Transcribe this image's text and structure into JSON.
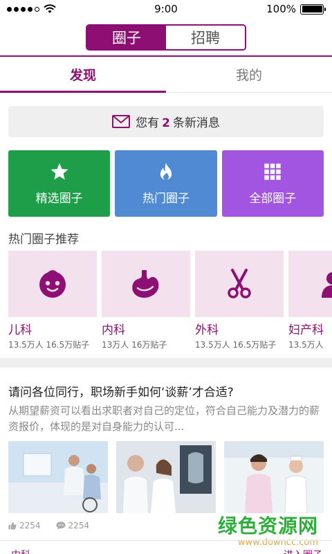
{
  "status_bar": {
    "time": "9:00",
    "battery": "100%"
  },
  "header": {
    "segments": [
      {
        "label": "圈子",
        "active": true
      },
      {
        "label": "招聘",
        "active": false
      }
    ]
  },
  "subtabs": [
    {
      "label": "发现",
      "active": true
    },
    {
      "label": "我的",
      "active": false
    }
  ],
  "message_bar": {
    "prefix": "您有",
    "count": "2",
    "suffix": "条新消息"
  },
  "tiles": [
    {
      "label": "精选圈子",
      "icon": "star-icon",
      "color": "#1f9e4a"
    },
    {
      "label": "热门圈子",
      "icon": "flame-icon",
      "color": "#4f8ad3"
    },
    {
      "label": "全部圈子",
      "icon": "grid-icon",
      "color": "#a155e0"
    }
  ],
  "hot_section": {
    "title": "热门圈子推荐"
  },
  "circles": [
    {
      "name": "儿科",
      "meta": "13.5万人 16.5万贴子",
      "icon": "baby-face-icon"
    },
    {
      "name": "内科",
      "meta": "13万人 16万贴子",
      "icon": "stomach-icon"
    },
    {
      "name": "外科",
      "meta": "13.5万人 16.5万贴子",
      "icon": "scissors-icon"
    },
    {
      "name": "妇产科",
      "meta": "13.5万人",
      "icon": "woman-icon"
    }
  ],
  "article": {
    "title": "请问各位同行，职场新手如何‘谈薪’才合适?",
    "desc": "从期望薪资可以看出求职者对自己的定位，符合自己能力及潜力的薪资报价，体现的是对自身能力的认可...",
    "likes": "2254",
    "comments": "2254"
  },
  "watermark": {
    "main": "绿色资源网",
    "url": "www.downcc.com"
  },
  "bottom": {
    "left": "内科",
    "right": "进入圈子"
  },
  "colors": {
    "brand": "#8e0f73",
    "tile_green": "#1f9e4a",
    "tile_blue": "#4f8ad3",
    "tile_purple": "#a155e0"
  }
}
